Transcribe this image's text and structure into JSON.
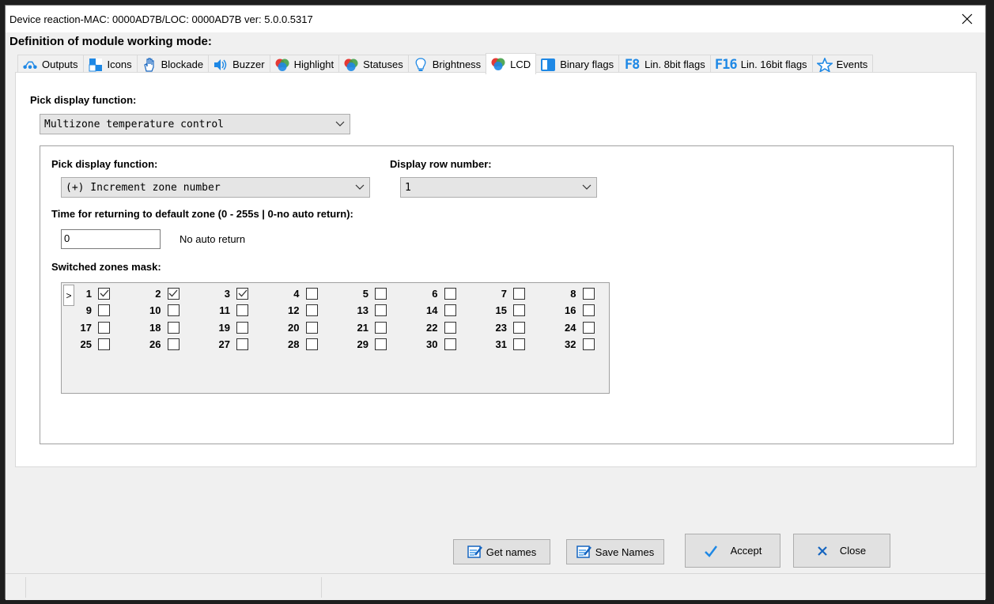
{
  "window": {
    "title": "Device reaction-MAC: 0000AD7B/LOC: 0000AD7B ver: 5.0.0.5317",
    "heading": "Definition of module working mode:"
  },
  "tabs": [
    {
      "label": "Outputs",
      "icon": "outputs-icon"
    },
    {
      "label": "Icons",
      "icon": "icons-icon"
    },
    {
      "label": "Blockade",
      "icon": "hand-icon"
    },
    {
      "label": "Buzzer",
      "icon": "speaker-icon"
    },
    {
      "label": "Highlight",
      "icon": "rgb-circles-icon"
    },
    {
      "label": "Statuses",
      "icon": "rgb-circles-icon"
    },
    {
      "label": "Brightness",
      "icon": "bulb-icon"
    },
    {
      "label": "LCD",
      "icon": "rgb-circles-icon",
      "active": true
    },
    {
      "label": "Binary flags",
      "icon": "binary-flag-icon"
    },
    {
      "label": "Lin. 8bit flags",
      "icon": "f8-icon",
      "icon_text": "F8"
    },
    {
      "label": "Lin. 16bit flags",
      "icon": "f16-icon",
      "icon_text": "F16"
    },
    {
      "label": "Events",
      "icon": "star-icon"
    }
  ],
  "lcd": {
    "display_function_label": "Pick display function:",
    "display_function_value": "Multizone temperature control",
    "sub_function_label": "Pick display function:",
    "sub_function_value": "(+) Increment zone number",
    "row_number_label": "Display row number:",
    "row_number_value": "1",
    "return_time_label": "Time for returning to default zone (0 - 255s | 0-no auto return):",
    "return_time_value": "0",
    "return_time_note": "No auto return",
    "zones_mask_label": "Switched zones mask:",
    "row_selector": ">",
    "zones": [
      {
        "n": "1",
        "checked": true
      },
      {
        "n": "2",
        "checked": true
      },
      {
        "n": "3",
        "checked": true
      },
      {
        "n": "4",
        "checked": false
      },
      {
        "n": "5",
        "checked": false
      },
      {
        "n": "6",
        "checked": false
      },
      {
        "n": "7",
        "checked": false
      },
      {
        "n": "8",
        "checked": false
      },
      {
        "n": "9",
        "checked": false
      },
      {
        "n": "10",
        "checked": false
      },
      {
        "n": "11",
        "checked": false
      },
      {
        "n": "12",
        "checked": false
      },
      {
        "n": "13",
        "checked": false
      },
      {
        "n": "14",
        "checked": false
      },
      {
        "n": "15",
        "checked": false
      },
      {
        "n": "16",
        "checked": false
      },
      {
        "n": "17",
        "checked": false
      },
      {
        "n": "18",
        "checked": false
      },
      {
        "n": "19",
        "checked": false
      },
      {
        "n": "20",
        "checked": false
      },
      {
        "n": "21",
        "checked": false
      },
      {
        "n": "22",
        "checked": false
      },
      {
        "n": "23",
        "checked": false
      },
      {
        "n": "24",
        "checked": false
      },
      {
        "n": "25",
        "checked": false
      },
      {
        "n": "26",
        "checked": false
      },
      {
        "n": "27",
        "checked": false
      },
      {
        "n": "28",
        "checked": false
      },
      {
        "n": "29",
        "checked": false
      },
      {
        "n": "30",
        "checked": false
      },
      {
        "n": "31",
        "checked": false
      },
      {
        "n": "32",
        "checked": false
      }
    ]
  },
  "buttons": {
    "get_names": "Get names",
    "save_names": "Save Names",
    "accept": "Accept",
    "close": "Close"
  },
  "colors": {
    "accent_blue": "#1e88e5",
    "close_blue": "#1565c0"
  }
}
